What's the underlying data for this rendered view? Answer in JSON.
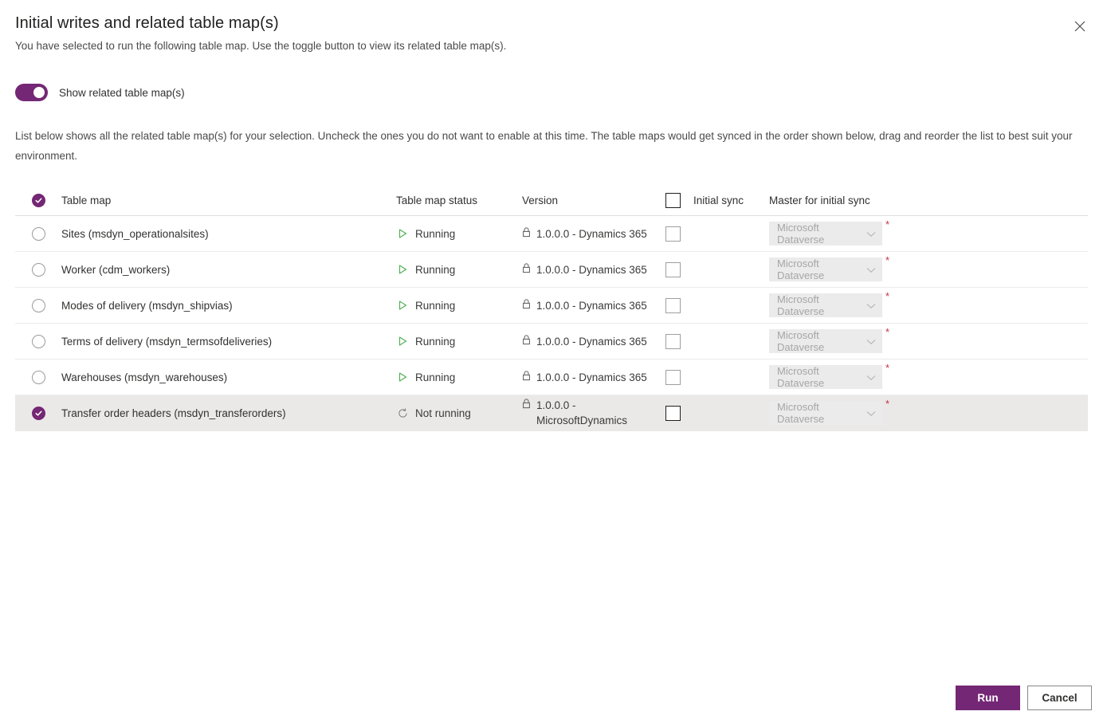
{
  "dialog": {
    "title": "Initial writes and related table map(s)",
    "subtitle": "You have selected to run the following table map. Use the toggle button to view its related table map(s).",
    "close_icon": "close-icon",
    "description": "List below shows all the related table map(s) for your selection. Uncheck the ones you do not want to enable at this time. The table maps would get synced in the order shown below, drag and reorder the list to best suit your environment.",
    "accent_color": "#742774"
  },
  "toggle": {
    "label": "Show related table map(s)",
    "state": "on"
  },
  "table": {
    "headers": {
      "select_all": "select-all-checked",
      "table_map": "Table map",
      "table_map_status": "Table map status",
      "version": "Version",
      "initial_sync": "Initial sync",
      "master_for_initial_sync": "Master for initial sync"
    },
    "rows": [
      {
        "selected": false,
        "name": "Sites (msdyn_operationalsites)",
        "status": "Running",
        "status_icon": "play-icon",
        "version": "1.0.0.0 - Dynamics 365",
        "version_icon": "lock-icon",
        "initial_sync_checked": false,
        "master": "Microsoft Dataverse",
        "required": "*"
      },
      {
        "selected": false,
        "name": "Worker (cdm_workers)",
        "status": "Running",
        "status_icon": "play-icon",
        "version": "1.0.0.0 - Dynamics 365",
        "version_icon": "lock-icon",
        "initial_sync_checked": false,
        "master": "Microsoft Dataverse",
        "required": "*"
      },
      {
        "selected": false,
        "name": "Modes of delivery (msdyn_shipvias)",
        "status": "Running",
        "status_icon": "play-icon",
        "version": "1.0.0.0 - Dynamics 365",
        "version_icon": "lock-icon",
        "initial_sync_checked": false,
        "master": "Microsoft Dataverse",
        "required": "*"
      },
      {
        "selected": false,
        "name": "Terms of delivery (msdyn_termsofdeliveries)",
        "status": "Running",
        "status_icon": "play-icon",
        "version": "1.0.0.0 - Dynamics 365",
        "version_icon": "lock-icon",
        "initial_sync_checked": false,
        "master": "Microsoft Dataverse",
        "required": "*"
      },
      {
        "selected": false,
        "name": "Warehouses (msdyn_warehouses)",
        "status": "Running",
        "status_icon": "play-icon",
        "version": "1.0.0.0 - Dynamics 365",
        "version_icon": "lock-icon",
        "initial_sync_checked": false,
        "master": "Microsoft Dataverse",
        "required": "*"
      },
      {
        "selected": true,
        "name": "Transfer order headers (msdyn_transferorders)",
        "status": "Not running",
        "status_icon": "not-running-icon",
        "version": "1.0.0.0 - MicrosoftDynamics",
        "version_icon": "lock-icon",
        "initial_sync_checked": false,
        "master": "Microsoft Dataverse",
        "required": "*"
      }
    ]
  },
  "footer": {
    "run_label": "Run",
    "cancel_label": "Cancel"
  }
}
